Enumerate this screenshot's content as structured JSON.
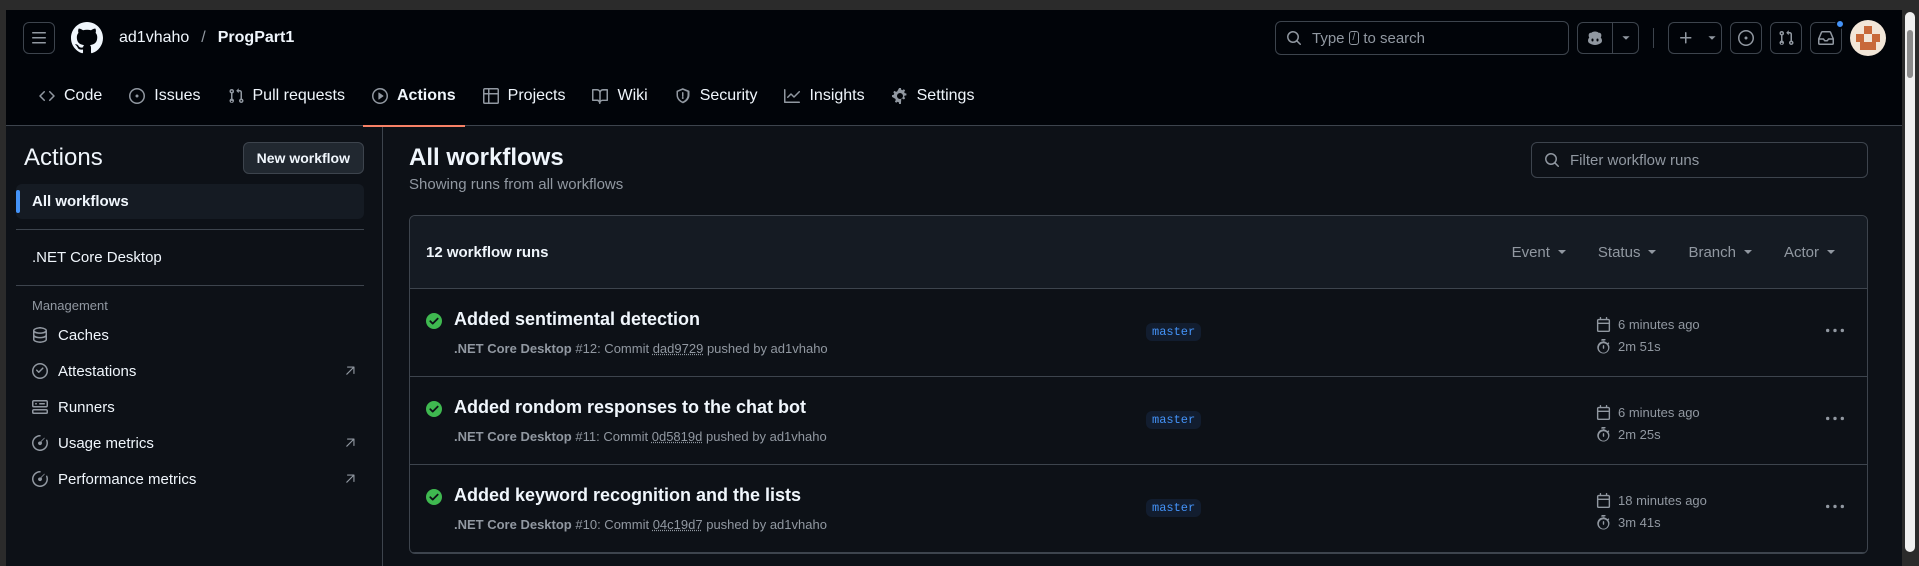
{
  "topbar": {
    "owner": "ad1vhaho",
    "separator": "/",
    "repo": "ProgPart1",
    "search_prefix": "Type",
    "search_key": "/",
    "search_suffix": "to search"
  },
  "tabs": [
    {
      "label": "Code",
      "icon": "code-icon"
    },
    {
      "label": "Issues",
      "icon": "issue-icon"
    },
    {
      "label": "Pull requests",
      "icon": "pull-request-icon"
    },
    {
      "label": "Actions",
      "icon": "play-icon",
      "active": true
    },
    {
      "label": "Projects",
      "icon": "table-icon"
    },
    {
      "label": "Wiki",
      "icon": "book-icon"
    },
    {
      "label": "Security",
      "icon": "shield-icon"
    },
    {
      "label": "Insights",
      "icon": "graph-icon"
    },
    {
      "label": "Settings",
      "icon": "gear-icon"
    }
  ],
  "sidebar": {
    "title": "Actions",
    "new_workflow": "New workflow",
    "all_workflows": "All workflows",
    "workflow": ".NET Core Desktop",
    "management_label": "Management",
    "management": [
      {
        "label": "Caches",
        "icon": "database-icon",
        "external": false
      },
      {
        "label": "Attestations",
        "icon": "verified-icon",
        "external": true
      },
      {
        "label": "Runners",
        "icon": "server-icon",
        "external": false
      },
      {
        "label": "Usage metrics",
        "icon": "meter-icon",
        "external": true
      },
      {
        "label": "Performance metrics",
        "icon": "meter-icon",
        "external": true
      }
    ]
  },
  "main": {
    "title": "All workflows",
    "subtitle": "Showing runs from all workflows",
    "filter_placeholder": "Filter workflow runs",
    "runs_count": "12 workflow runs",
    "filters": [
      "Event",
      "Status",
      "Branch",
      "Actor"
    ],
    "runs": [
      {
        "title": "Added sentimental detection",
        "workflow": ".NET Core Desktop",
        "number": "#12",
        "commit_label": ": Commit",
        "sha": "dad9729",
        "pushed_by": "pushed by ad1vhaho",
        "branch": "master",
        "time": "6 minutes ago",
        "duration": "2m 51s"
      },
      {
        "title": "Added rondom responses to the chat bot",
        "workflow": ".NET Core Desktop",
        "number": "#11",
        "commit_label": ": Commit",
        "sha": "0d5819d",
        "pushed_by": "pushed by ad1vhaho",
        "branch": "master",
        "time": "6 minutes ago",
        "duration": "2m 25s"
      },
      {
        "title": "Added keyword recognition and the lists",
        "workflow": ".NET Core Desktop",
        "number": "#10",
        "commit_label": ": Commit",
        "sha": "04c19d7",
        "pushed_by": "pushed by ad1vhaho",
        "branch": "master",
        "time": "18 minutes ago",
        "duration": "3m 41s"
      }
    ]
  },
  "colors": {
    "success": "#3fb950",
    "accent": "#4493f8",
    "active_tab_underline": "#f78166"
  }
}
